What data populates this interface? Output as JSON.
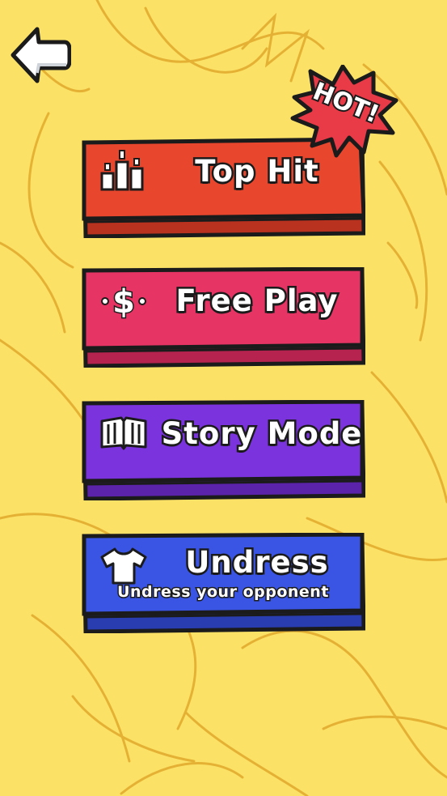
{
  "colors": {
    "background": "#fbe266",
    "sketch": "#e2a92c",
    "top_hit": "#e8472e",
    "free_play": "#e63565",
    "story_mode": "#7b33de",
    "undress": "#3a55e3",
    "hot_badge": "#e83a47",
    "outline": "#1b1b1b"
  },
  "back_button": {
    "icon": "back-arrow-icon"
  },
  "hot_badge": {
    "label": "HOT!"
  },
  "menu": [
    {
      "label": "Top Hit",
      "icon": "podium-icon"
    },
    {
      "label": "Free Play",
      "icon": "dollar-icon"
    },
    {
      "label": "Story Mode",
      "icon": "book-icon"
    },
    {
      "label": "Undress",
      "subtitle": "Undress your opponent",
      "icon": "shirt-icon"
    }
  ]
}
